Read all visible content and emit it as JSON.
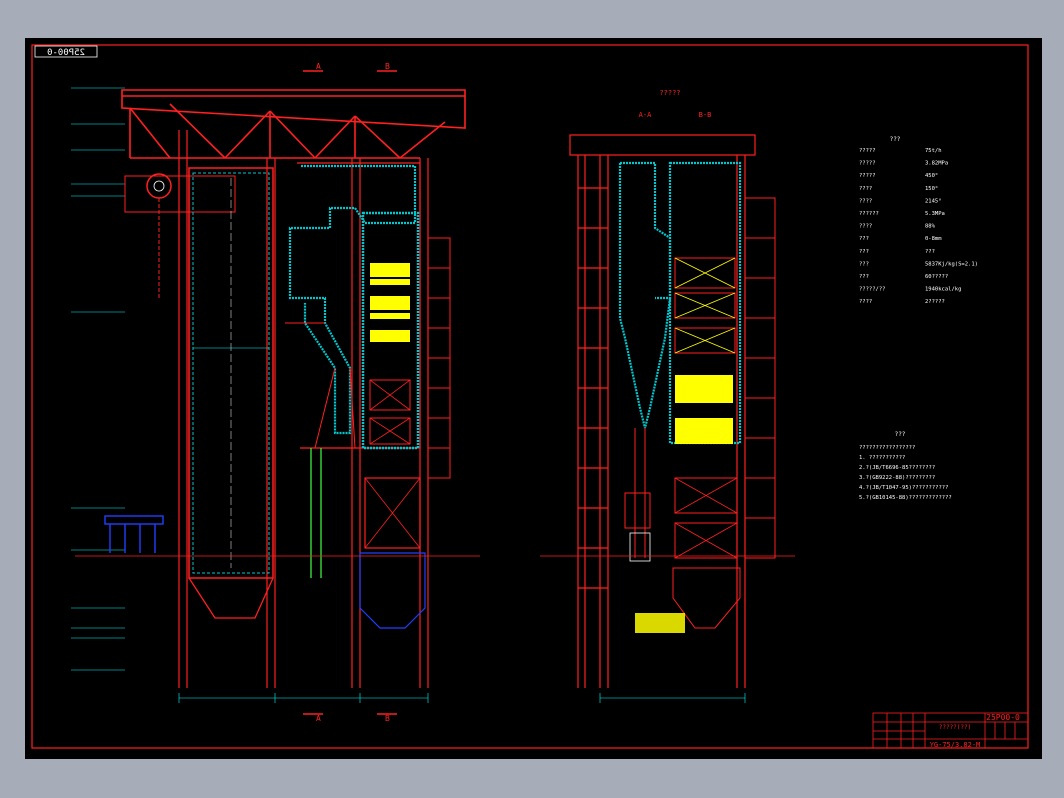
{
  "drawing": {
    "stamp_mirrored": "25P00-0",
    "left_view": {
      "section_a": "A",
      "section_b": "B",
      "bottom_a": "A",
      "bottom_b": "B"
    },
    "right_view": {
      "title": "?????",
      "label_aa": "A-A",
      "label_bb": "B-B"
    },
    "specs": {
      "heading": "???",
      "rows": [
        {
          "label": "?????",
          "value": "75t/h"
        },
        {
          "label": "?????",
          "value": "3.82MPa"
        },
        {
          "label": "?????",
          "value": "450°"
        },
        {
          "label": "????",
          "value": "150°"
        },
        {
          "label": "????",
          "value": "2145°"
        },
        {
          "label": "??????",
          "value": "5.3MPa"
        },
        {
          "label": "????",
          "value": "88%"
        },
        {
          "label": "???",
          "value": "0-8mm"
        },
        {
          "label": "???",
          "value": "???"
        },
        {
          "label": "???",
          "value": "5837Kj/kg(S=2.1)"
        },
        {
          "label": "???",
          "value": "60?????"
        },
        {
          "label": "?????/??",
          "value": "1940kcal/kg"
        },
        {
          "label": "????",
          "value": "2?????"
        }
      ]
    },
    "notes": {
      "heading": "???",
      "lines": [
        "?????????????????",
        "1. ???????????",
        "2.?(JB/T6696-85????????",
        "3.?(GB9222-88)?????????",
        "4.?(JB/T1047-95)???????????",
        "5.?(GB10145-88)?????????????"
      ]
    },
    "title_block": {
      "drawing_no": "25P00-0",
      "name": "?????(??)",
      "model": "YG-75/3.82-M"
    }
  },
  "colors": {
    "frame": "#ff2020",
    "outline": "#ff0000",
    "insulation": "#00c8d0",
    "dim": "#00ffff",
    "fill": "#ffff00",
    "center": "#ffffff",
    "text": "#ffffff",
    "steel": "#ff2020",
    "hopper": "#2040ff",
    "pipe": "#40ff40"
  }
}
